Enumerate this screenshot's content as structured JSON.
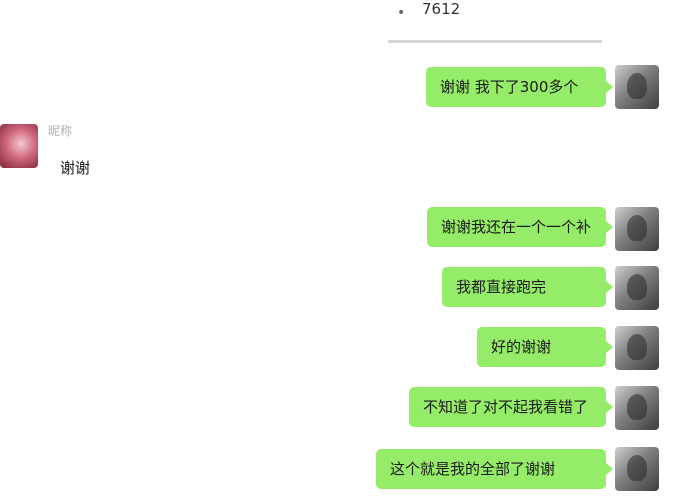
{
  "quoted_message": {
    "text": "7612"
  },
  "other_user": {
    "name": "昵称"
  },
  "messages": [
    {
      "sender": "self",
      "text": "谢谢 我下了300多个"
    },
    {
      "sender": "other",
      "text": "谢谢"
    },
    {
      "sender": "self",
      "text": "谢谢我还在一个一个补"
    },
    {
      "sender": "self",
      "text": "我都直接跑完"
    },
    {
      "sender": "self",
      "text": "好的谢谢"
    },
    {
      "sender": "self",
      "text": "不知道了对不起我看错了"
    },
    {
      "sender": "self",
      "text": "这个就是我的全部了谢谢"
    }
  ],
  "colors": {
    "self_bubble": "#95ec69",
    "background": "#ffffff"
  }
}
